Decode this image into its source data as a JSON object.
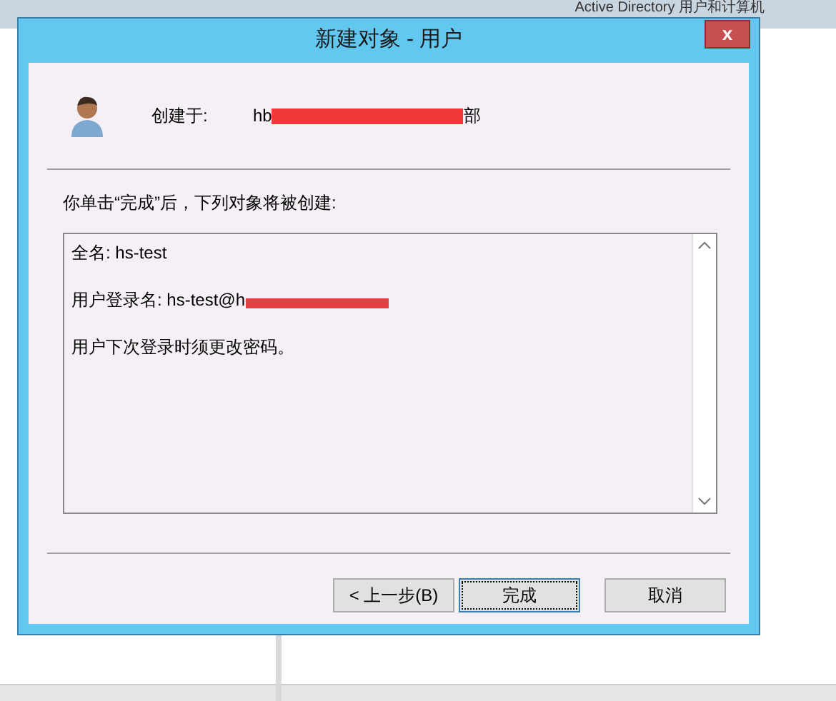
{
  "background_window": {
    "title": "Active Directory 用户和计算机"
  },
  "dialog": {
    "title": "新建对象 - 用户",
    "close": "x",
    "created_in": {
      "label": "创建于:",
      "value_start": "hb",
      "value_end": "部"
    },
    "intro": "你单击“完成”后，下列对象将被创建:",
    "summary": [
      {
        "kind": "line",
        "text": "全名: hs-test"
      },
      {
        "kind": "redacted",
        "text": "用户登录名: hs-test@h"
      },
      {
        "kind": "line",
        "text": "用户下次登录时须更改密码。"
      }
    ],
    "buttons": [
      {
        "label": "< 上一步(B)",
        "selected": false
      },
      {
        "label": "完成",
        "selected": true
      },
      {
        "label": "取消",
        "selected": false
      }
    ]
  }
}
